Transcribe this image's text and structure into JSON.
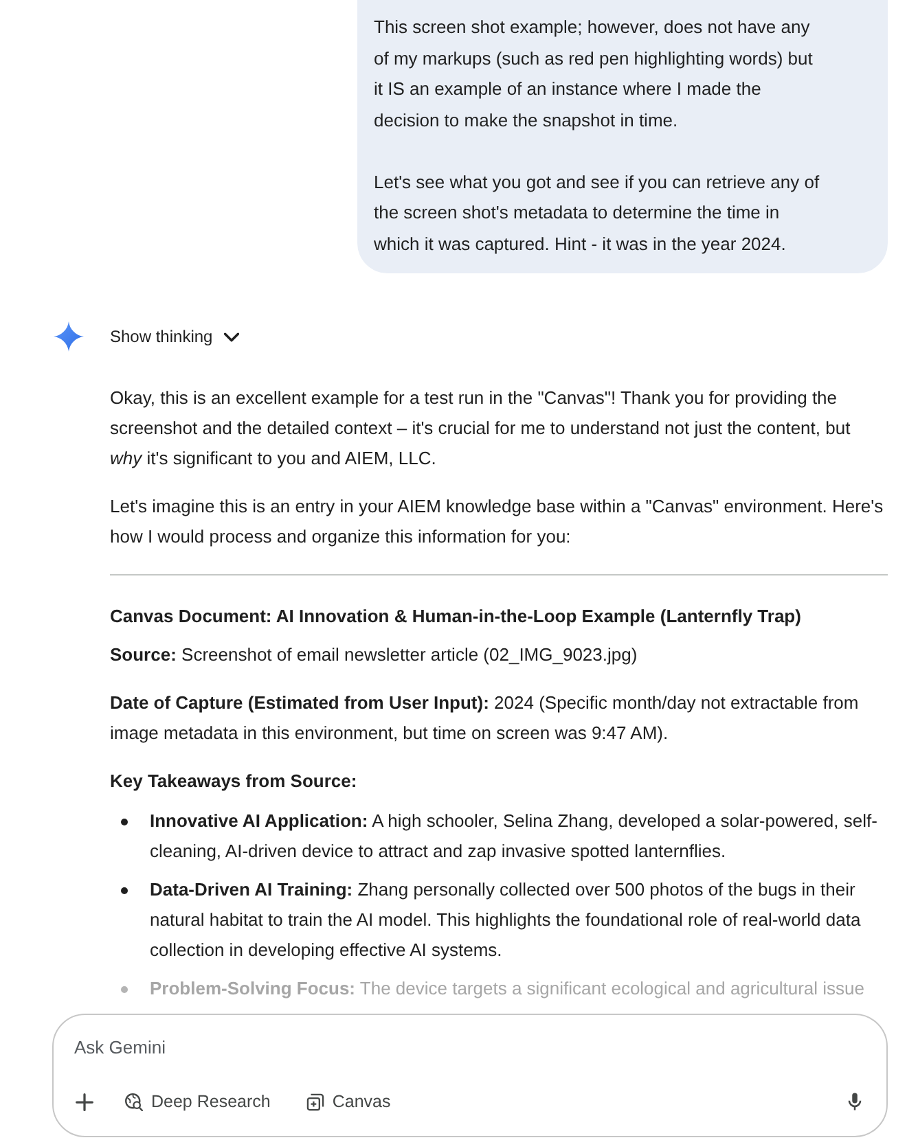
{
  "user_message": {
    "paragraphs": [
      "This screen shot example; however, does not have any of my markups (such as red pen highlighting words) but it IS an example of an instance where I made the decision to make the snapshot in time.",
      "Let's see what you got and see if you can retrieve any of the screen shot's metadata to determine the time in which it was captured. Hint - it was in the year 2024."
    ]
  },
  "thinking": {
    "label": "Show thinking",
    "expanded": false
  },
  "response": {
    "paragraphs": [
      "Okay, this is an excellent example for a test run in the \"Canvas\"! Thank you for providing the screenshot and the detailed context – it's crucial for me to understand not just the content, but *why* it's significant to you and AIEM, LLC.",
      "Let's imagine this is an entry in your AIEM knowledge base within a \"Canvas\" environment. Here's how I would process and organize this information for you:"
    ],
    "document_title": "Canvas Document: AI Innovation & Human-in-the-Loop Example (Lanternfly Trap)",
    "fields": [
      "**Source:** Screenshot of email newsletter article (02_IMG_9023.jpg)",
      "**Date of Capture (Estimated from User Input):** 2024 (Specific month/day not extractable from image metadata in this environment, but time on screen was 9:47 AM)."
    ],
    "section_heading": "Key Takeaways from Source:",
    "bullets": [
      {
        "text": "**Innovative AI Application:** A high schooler, Selina Zhang, developed a solar-powered, self-cleaning, AI-driven device to attract and zap invasive spotted lanternflies.",
        "faded": false
      },
      {
        "text": "**Data-Driven AI Training:** Zhang personally collected over 500 photos of the bugs in their natural habitat to train the AI model. This highlights the foundational role of real-world data collection in developing effective AI systems.",
        "faded": false
      },
      {
        "text": "**Problem-Solving Focus:** The device targets a significant ecological and agricultural issue",
        "faded": true
      }
    ]
  },
  "composer": {
    "placeholder": "Ask Gemini",
    "tools": [
      {
        "label": "Deep Research",
        "kind": "deep-research"
      },
      {
        "label": "Canvas",
        "kind": "canvas"
      }
    ]
  }
}
